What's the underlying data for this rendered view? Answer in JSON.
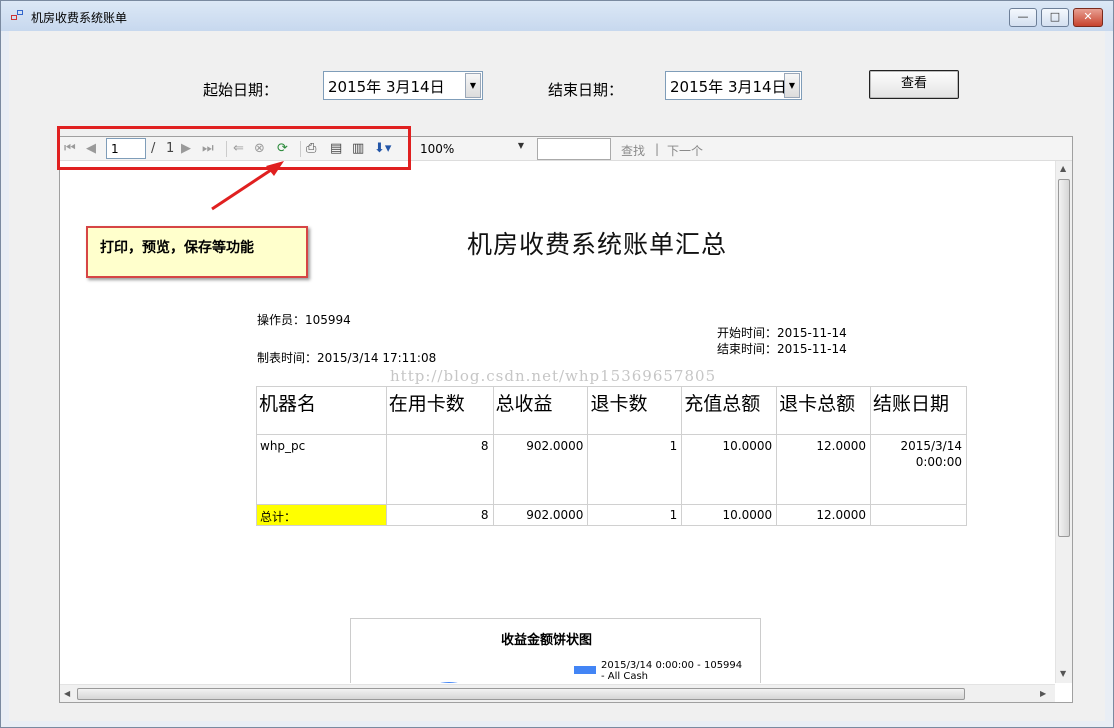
{
  "window": {
    "title": "机房收费系统账单",
    "minimize": "—",
    "maximize": "□",
    "close": "✕"
  },
  "form": {
    "start_label": "起始日期：",
    "start_value": "2015年  3月14日",
    "end_label": "结束日期：",
    "end_value": "2015年  3月14日",
    "view_button": "查看"
  },
  "viewer_toolbar": {
    "page_current": "1",
    "page_sep": "/",
    "page_total": "1",
    "zoom": "100%",
    "find_label": "查找",
    "find_sep": "|",
    "next_label": "下一个",
    "icons": [
      "first-page-icon",
      "prev-page-icon",
      "next-page-icon",
      "last-page-icon",
      "back-icon",
      "stop-icon",
      "refresh-icon",
      "print-icon",
      "print-layout-icon",
      "page-setup-icon",
      "export-icon"
    ]
  },
  "annotation": {
    "callout_text": "打印，预览，保存等功能"
  },
  "report": {
    "title": "机房收费系统账单汇总",
    "operator": "操作员：105994",
    "created": "制表时间：2015/3/14  17:11:08",
    "start_time": "开始时间：2015-11-14",
    "end_time": "结束时间：2015-11-14",
    "watermark": "http://blog.csdn.net/whp15369657805",
    "columns": [
      "机器名",
      "在用卡数",
      "总收益",
      "退卡数",
      "充值总额",
      "退卡总额",
      "结账日期"
    ],
    "row": {
      "machine": "whp_pc",
      "cards": "8",
      "income": "902.0000",
      "refunds": "1",
      "recharge": "10.0000",
      "refund_total": "12.0000",
      "date_line1": "2015/3/14",
      "date_line2": "0:00:00"
    },
    "total": {
      "label": "总计：",
      "cards": "8",
      "income": "902.0000",
      "refunds": "1",
      "recharge": "10.0000",
      "refund_total": "12.0000"
    },
    "chart": {
      "title": "收益金额饼状图",
      "legend_line1": "2015/3/14 0:00:00 - 105994",
      "legend_line2": "- All Cash",
      "series_color": "#4385f5"
    }
  },
  "chart_data": {
    "type": "pie",
    "title": "收益金额饼状图",
    "categories": [
      "2015/3/14 0:00:00 - 105994 - All Cash"
    ],
    "values": [
      902
    ]
  },
  "colors": {
    "highlight_yellow": "#ffff00",
    "annotation_red": "#e02020",
    "callout_bg": "#ffffcc"
  }
}
